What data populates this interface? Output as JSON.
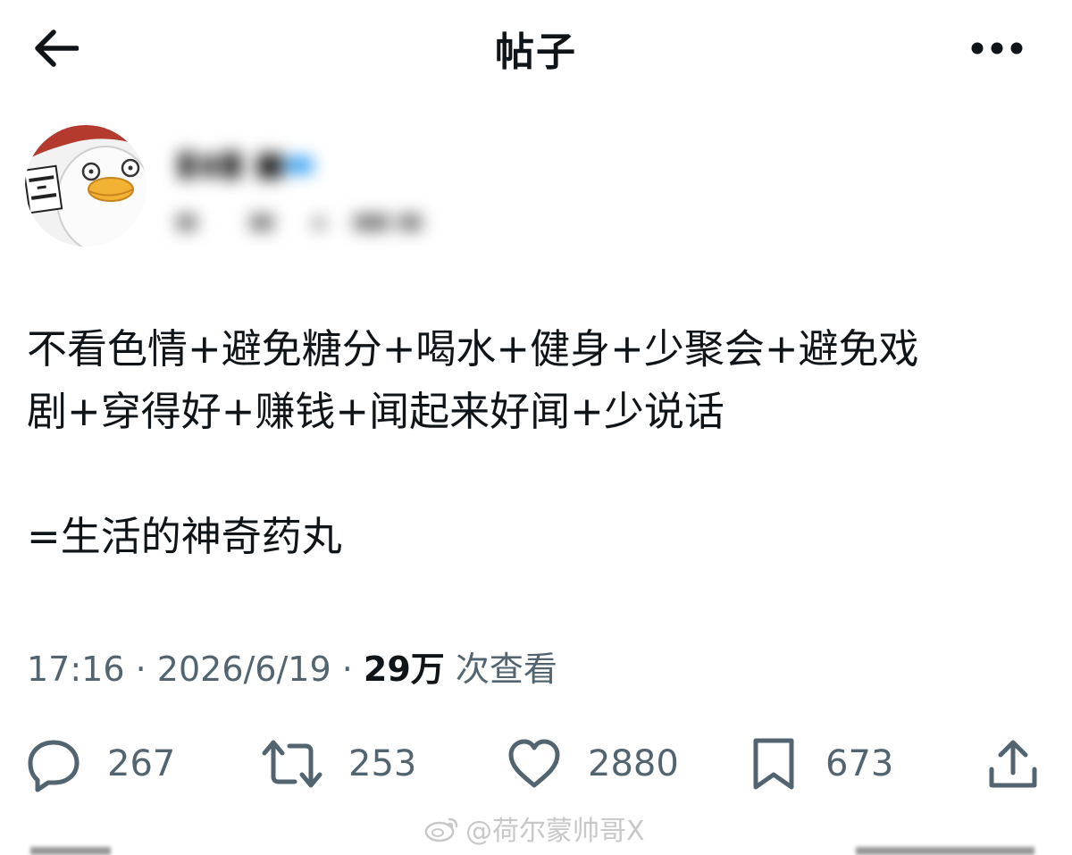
{
  "header": {
    "title": "帖子",
    "back_icon": "arrow-left-icon",
    "more_icon": "more-horizontal-icon"
  },
  "author": {
    "avatar_icon": "duck-avatar-icon",
    "name_blurred": true,
    "handle_blurred": true
  },
  "post": {
    "lines": [
      "不看色情+避免糖分+喝水+健身+少聚会+避免戏",
      "剧+穿得好+赚钱+闻起来好闻+少说话",
      "=生活的神奇药丸"
    ]
  },
  "meta": {
    "time": "17:16",
    "separator": "·",
    "date": "2026/6/19",
    "views_count": "29万",
    "views_label": "次查看"
  },
  "actions": {
    "reply_count": "267",
    "retweet_count": "253",
    "like_count": "2880",
    "bookmark_count": "673"
  },
  "watermark": {
    "text": "@荷尔蒙帅哥X"
  },
  "colors": {
    "text": "#0f1419",
    "secondary": "#536471",
    "background": "#ffffff"
  }
}
